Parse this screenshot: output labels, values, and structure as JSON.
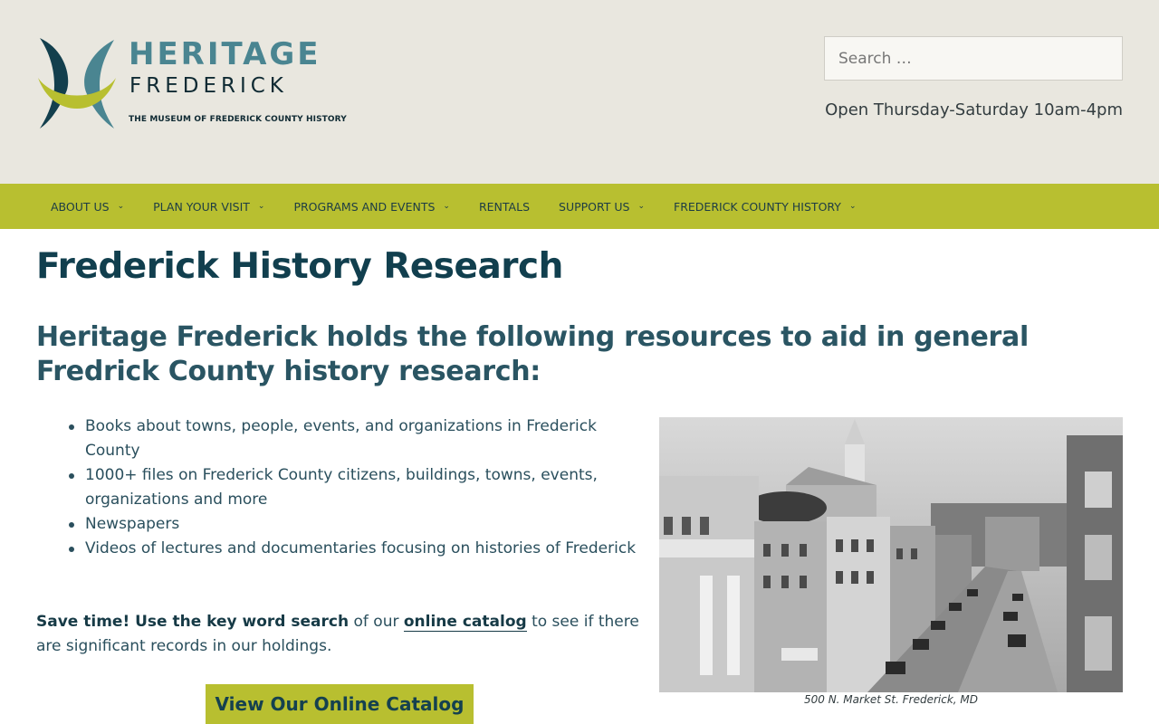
{
  "header": {
    "logo": {
      "word1": "HERITAGE",
      "word2": "FREDERICK",
      "tagline": "THE MUSEUM OF FREDERICK COUNTY HISTORY"
    },
    "search_placeholder": "Search …",
    "hours": "Open Thursday-Saturday 10am-4pm"
  },
  "nav": {
    "items": [
      {
        "label": "ABOUT US",
        "has_dropdown": true
      },
      {
        "label": "PLAN YOUR VISIT",
        "has_dropdown": true
      },
      {
        "label": "PROGRAMS AND EVENTS",
        "has_dropdown": true
      },
      {
        "label": "RENTALS",
        "has_dropdown": false
      },
      {
        "label": "SUPPORT US",
        "has_dropdown": true
      },
      {
        "label": "FREDERICK COUNTY HISTORY",
        "has_dropdown": true
      }
    ],
    "caret": "⌄"
  },
  "main": {
    "title": "Frederick History Research",
    "subtitle": "Heritage Frederick holds the following resources to aid in general Fredrick County history research:",
    "resources": [
      "Books about towns, people, events, and organizations in Frederick County",
      "1000+ files on Frederick County citizens, buildings, towns, events, organizations and more",
      "Newspapers",
      "Videos of lectures and documentaries focusing on histories of Frederick"
    ],
    "tip": {
      "bold": "Save time! Use the key word search",
      "before_link": " of our ",
      "link": "online catalog",
      "after_link": " to see if there are significant records in our holdings."
    },
    "button_label": "View Our Online Catalog",
    "photo_caption": "500 N. Market St. Frederick, MD"
  },
  "colors": {
    "header_bg": "#e9e7df",
    "nav_bg": "#b8bf30",
    "brand_teal": "#4a8591",
    "heading": "#113f4e"
  },
  "icons": {
    "nav_caret": "chevron-down-icon",
    "logo_mark": "heritage-logo-mark"
  }
}
